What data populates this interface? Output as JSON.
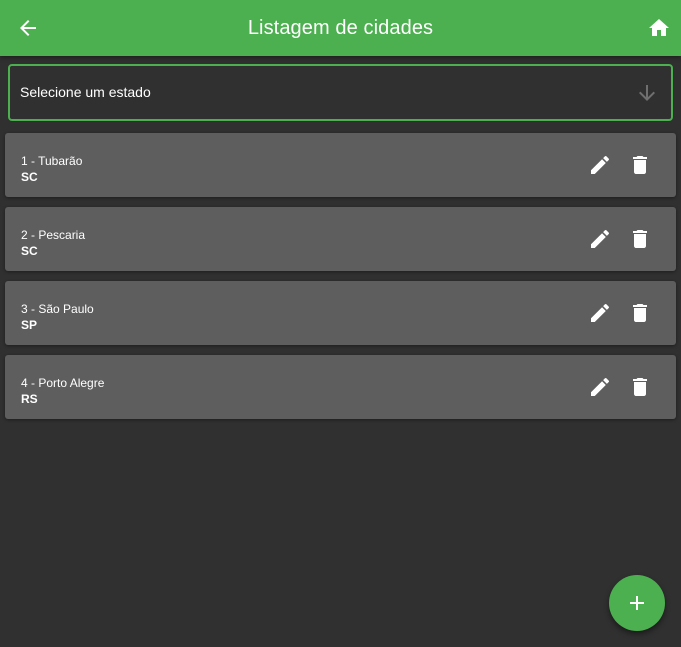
{
  "header": {
    "title": "Listagem de cidades"
  },
  "state_select": {
    "label": "Selecione um estado"
  },
  "cities": [
    {
      "name": "1 - Tubarão",
      "uf": "SC"
    },
    {
      "name": "2 - Pescaria",
      "uf": "SC"
    },
    {
      "name": "3 - São Paulo",
      "uf": "SP"
    },
    {
      "name": "4 - Porto Alegre",
      "uf": "RS"
    }
  ],
  "icons": {
    "back": "arrow-left-icon",
    "home": "home-icon",
    "dropdown": "arrow-down-icon",
    "edit": "pencil-icon",
    "delete": "trash-icon",
    "add": "plus-icon"
  },
  "colors": {
    "accent": "#4caf50",
    "background": "#303030",
    "card": "#5e5e5e",
    "text": "#ffffff"
  }
}
